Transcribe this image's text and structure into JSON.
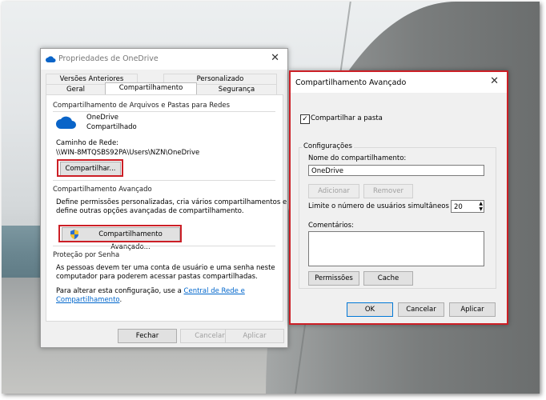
{
  "props": {
    "title": "Propriedades de OneDrive",
    "tabs_top": [
      "Versões Anteriores",
      "Personalizado"
    ],
    "tabs_bottom": [
      "Geral",
      "Compartilhamento",
      "Segurança"
    ],
    "share_group": {
      "title": "Compartilhamento de Arquivos e Pastas para Redes",
      "name": "OneDrive",
      "status": "Compartilhado",
      "path_label": "Caminho de Rede:",
      "path_value": "\\\\WIN-8MTQSBS92PA\\Users\\NZN\\OneDrive",
      "share_button": "Compartilhar..."
    },
    "advanced_group": {
      "title": "Compartilhamento Avançado",
      "desc_line1": "Define permissões personalizadas, cria vários compartilhamentos e",
      "desc_line2": "define outras opções avançadas de compartilhamento.",
      "button": "Compartilhamento Avançado..."
    },
    "password_group": {
      "title": "Proteção por Senha",
      "line1": "As pessoas devem ter uma conta de usuário e uma senha neste",
      "line2": "computador para poderem acessar pastas compartilhadas.",
      "change_prefix": "Para alterar esta configuração, use a",
      "link1": "Central de Rede e",
      "link2": "Compartilhamento",
      "suffix": "."
    },
    "buttons": {
      "close": "Fechar",
      "cancel": "Cancelar",
      "apply": "Aplicar"
    }
  },
  "adv": {
    "title": "Compartilhamento Avançado",
    "share_checkbox": {
      "label": "Compartilhar a pasta",
      "checked": true
    },
    "config_legend": "Configurações",
    "share_name_label": "Nome do compartilhamento:",
    "share_name_value": "OneDrive",
    "add_button": "Adicionar",
    "remove_button": "Remover",
    "limit_label": "Limite o número de usuários simultâneos a:",
    "limit_value": "20",
    "comments_label": "Comentários:",
    "permissions_button": "Permissões",
    "cache_button": "Cache",
    "ok_button": "OK",
    "cancel_button": "Cancelar",
    "apply_button": "Aplicar"
  },
  "colors": {
    "highlight": "#cc1f26",
    "link": "#0066cc",
    "onedrive_blue": "#0a64c8"
  }
}
